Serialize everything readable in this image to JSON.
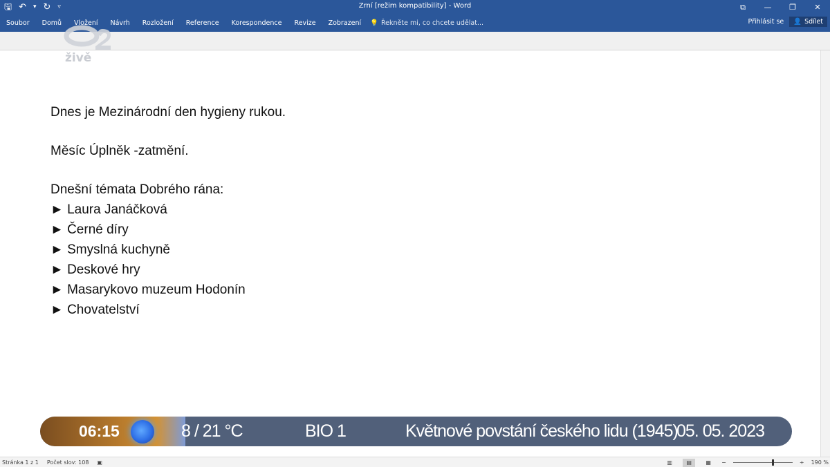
{
  "window": {
    "title": "Zrní [režim kompatibility] - Word",
    "controls": [
      "⧉",
      "—",
      "❐",
      "✕"
    ]
  },
  "qat": {
    "save_icon": "save-icon",
    "undo_icon": "undo-icon",
    "redo_icon": "redo-icon"
  },
  "ribbon": {
    "tabs": [
      "Soubor",
      "Domů",
      "Vložení",
      "Návrh",
      "Rozložení",
      "Reference",
      "Korespondence",
      "Revize",
      "Zobrazení"
    ],
    "tellme": "Řekněte mi, co chcete udělat...",
    "signin": "Přihlásit se",
    "share": "Sdílet"
  },
  "logo": {
    "text": "živě"
  },
  "document": {
    "line1": "Dnes je Mezinárodní den hygieny rukou.",
    "line2": "Měsíc Úplněk -zatmění.",
    "heading": "Dnešní témata Dobrého rána:",
    "bullets": [
      "► Laura Janáčková",
      "► Černé díry",
      "► Smyslná kuchyně",
      "► Deskové hry",
      "► Masarykovo muzeum Hodonín",
      "► Chovatelství"
    ]
  },
  "ticker": {
    "time": "06:15",
    "temp": "8 / 21 °C",
    "channel": "BIO 1",
    "event": "Květnové povstání českého lidu (1945)",
    "date": "05. 05. 2023"
  },
  "status": {
    "page": "Stránka 1 z 1",
    "words": "Počet slov: 108",
    "zoom": "190 %"
  },
  "colors": {
    "ribbon": "#2b579a",
    "ticker": "#51607a"
  }
}
